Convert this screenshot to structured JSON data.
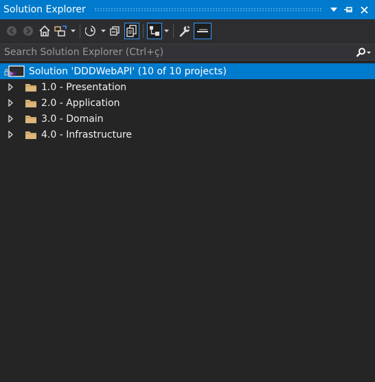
{
  "panel": {
    "title": "Solution Explorer"
  },
  "search": {
    "placeholder": "Search Solution Explorer (Ctrl+ç)"
  },
  "tree": {
    "solution_label": "Solution 'DDDWebAPI' (10 of 10 projects)",
    "folders": [
      {
        "label": "1.0 - Presentation"
      },
      {
        "label": "2.0 - Application"
      },
      {
        "label": "3.0 - Domain"
      },
      {
        "label": "4.0 - Infrastructure"
      }
    ]
  },
  "icons": {
    "folder_color": "#dcb67a",
    "accent": "#007acc"
  }
}
